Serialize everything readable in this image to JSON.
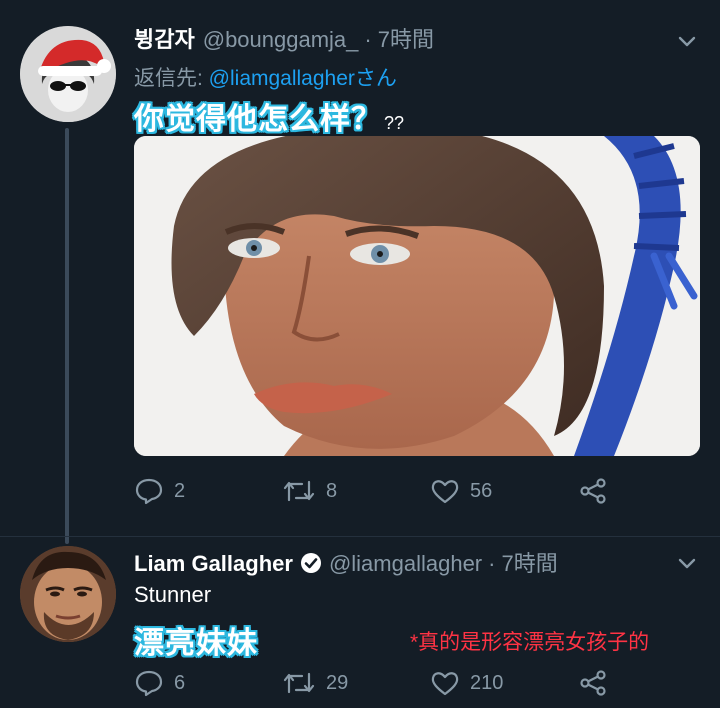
{
  "tweet1": {
    "display_name": "뷩감자",
    "handle": "@bounggamja_",
    "separator": "·",
    "time": "7時間",
    "reply_prefix": "返信先: ",
    "reply_mention": "@liamgallagher",
    "reply_suffix": "さん",
    "text_highlight": "你觉得他怎么样？",
    "text_tail": "??",
    "actions": {
      "replies": "2",
      "retweets": "8",
      "likes": "56"
    }
  },
  "tweet2": {
    "display_name": "Liam Gallagher",
    "handle": "@liamgallagher",
    "separator": "·",
    "time": "7時間",
    "text": "Stunner",
    "translation": "漂亮妹妹",
    "annotation": "*真的是形容漂亮女孩子的",
    "actions": {
      "replies": "6",
      "retweets": "29",
      "likes": "210"
    }
  },
  "colors": {
    "background": "#141d26",
    "secondary_text": "#8899a6",
    "mention_blue": "#1da1f2",
    "annotation_red": "#ff3344",
    "outline_cyan": "#2db8e0"
  },
  "icons": [
    "chevron-down-icon",
    "reply-icon",
    "retweet-icon",
    "like-icon",
    "share-icon",
    "verified-badge-icon"
  ]
}
